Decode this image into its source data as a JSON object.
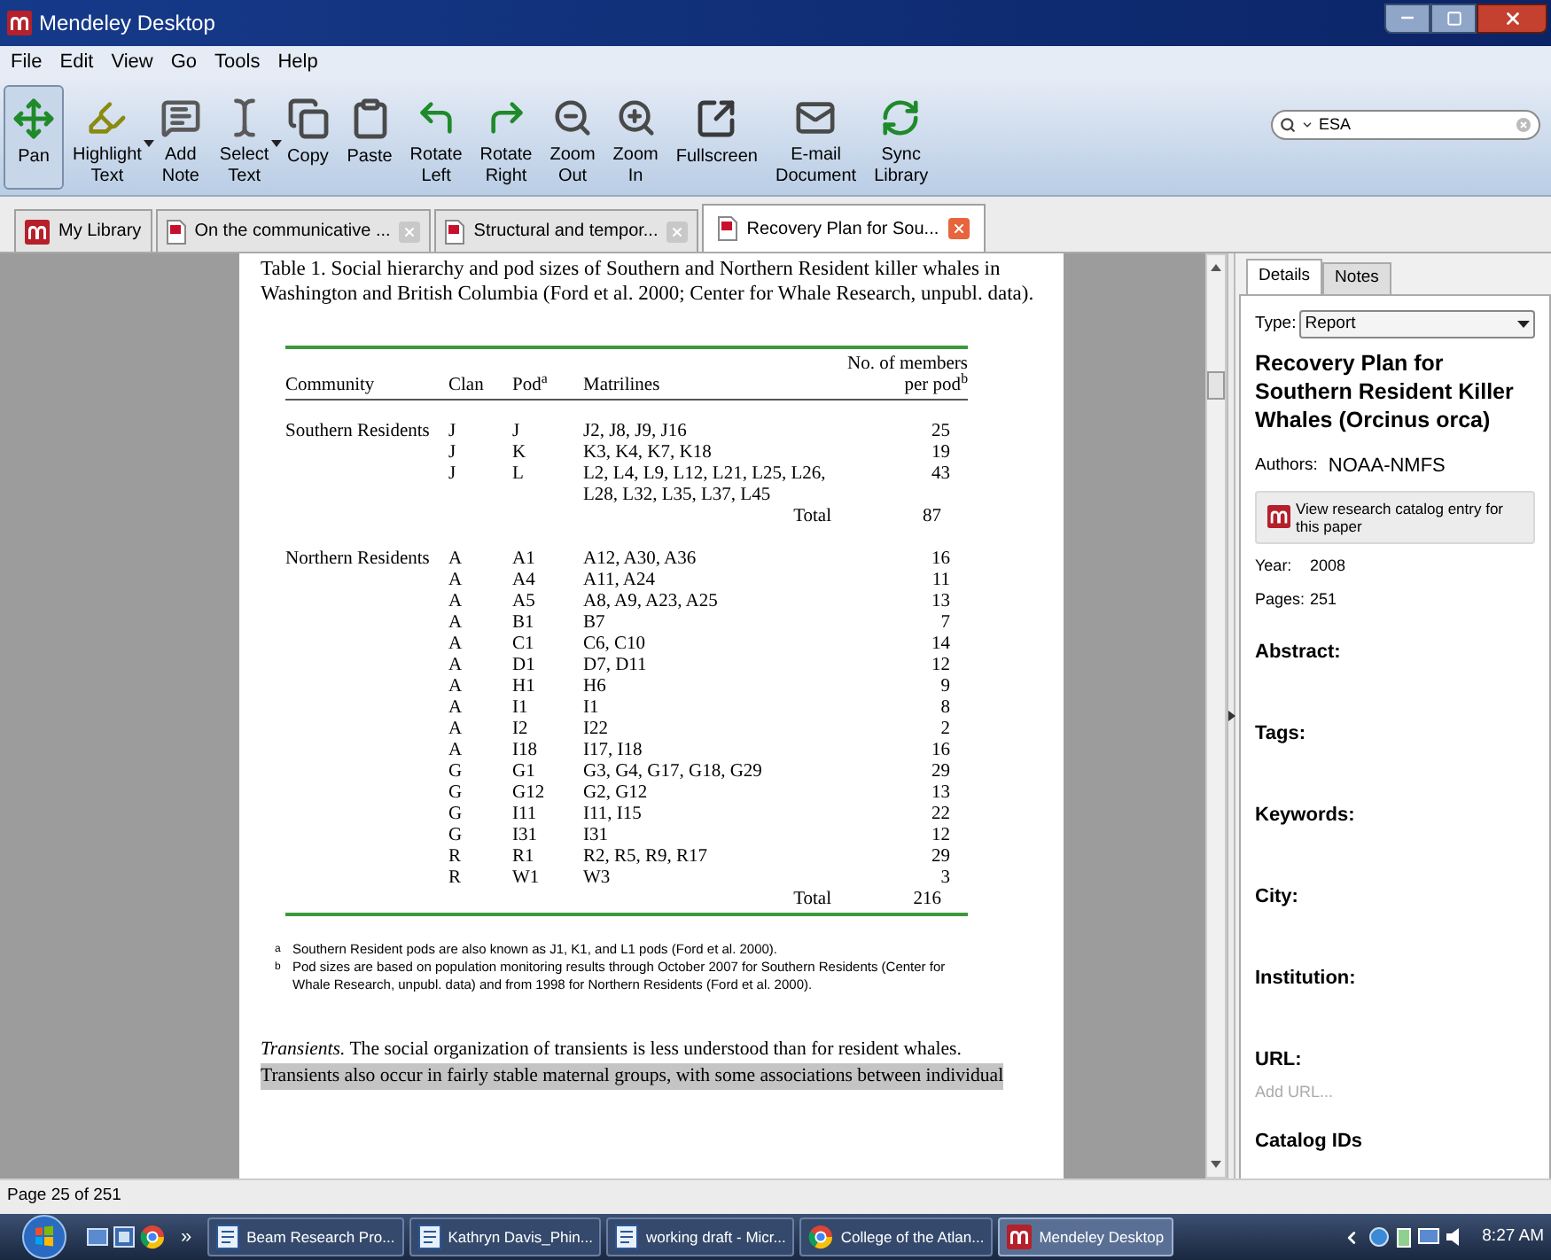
{
  "window": {
    "title": "Mendeley Desktop"
  },
  "menu": [
    "File",
    "Edit",
    "View",
    "Go",
    "Tools",
    "Help"
  ],
  "toolbar": [
    {
      "label": "Pan",
      "selected": true,
      "has_menu": false
    },
    {
      "label": "Highlight Text",
      "selected": false,
      "has_menu": true
    },
    {
      "label": "Add Note",
      "selected": false,
      "has_menu": false
    },
    {
      "label": "Select Text",
      "selected": false,
      "has_menu": true
    },
    {
      "label": "Copy",
      "selected": false,
      "has_menu": false
    },
    {
      "label": "Paste",
      "selected": false,
      "has_menu": false
    },
    {
      "label": "Rotate Left",
      "selected": false,
      "has_menu": false
    },
    {
      "label": "Rotate Right",
      "selected": false,
      "has_menu": false
    },
    {
      "label": "Zoom Out",
      "selected": false,
      "has_menu": false
    },
    {
      "label": "Zoom In",
      "selected": false,
      "has_menu": false
    },
    {
      "label": "Fullscreen",
      "selected": false,
      "has_menu": false
    },
    {
      "label": "E-mail Document",
      "selected": false,
      "has_menu": false
    },
    {
      "label": "Sync Library",
      "selected": false,
      "has_menu": false
    }
  ],
  "search": {
    "value": "ESA"
  },
  "tabs": [
    {
      "label": "My Library",
      "kind": "library",
      "selected": false,
      "closable": false
    },
    {
      "label": "On the communicative ...",
      "kind": "pdf",
      "selected": false,
      "closable": true
    },
    {
      "label": "Structural and tempor...",
      "kind": "pdf",
      "selected": false,
      "closable": true
    },
    {
      "label": "Recovery Plan for Sou...",
      "kind": "pdf",
      "selected": true,
      "closable": true
    }
  ],
  "document": {
    "caption": "Table 1. Social hierarchy and pod sizes of Southern and Northern Resident killer whales in Washington and British Columbia (Ford et al. 2000; Center for Whale Research, unpubl. data).",
    "table": {
      "columns": [
        "Community",
        "Clan",
        "Pod$^{a}$",
        "Matrilines",
        "No. of members per pod$^{b}$"
      ],
      "groups": [
        {
          "community": "Southern Residents",
          "rows": [
            {
              "clan": "J",
              "pod": "J",
              "matrilines": "J2, J8, J9, J16",
              "members": "25"
            },
            {
              "clan": "J",
              "pod": "K",
              "matrilines": "K3, K4, K7, K18",
              "members": "19"
            },
            {
              "clan": "J",
              "pod": "L",
              "matrilines": "L2, L4, L9, L12, L21, L25, L26, L28, L32, L35, L37, L45",
              "members": "43"
            }
          ],
          "total_label": "Total",
          "total": "87"
        },
        {
          "community": "Northern Residents",
          "rows": [
            {
              "clan": "A",
              "pod": "A1",
              "matrilines": "A12, A30, A36",
              "members": "16"
            },
            {
              "clan": "A",
              "pod": "A4",
              "matrilines": "A11, A24",
              "members": "11"
            },
            {
              "clan": "A",
              "pod": "A5",
              "matrilines": "A8, A9, A23, A25",
              "members": "13"
            },
            {
              "clan": "A",
              "pod": "B1",
              "matrilines": "B7",
              "members": "7"
            },
            {
              "clan": "A",
              "pod": "C1",
              "matrilines": "C6, C10",
              "members": "14"
            },
            {
              "clan": "A",
              "pod": "D1",
              "matrilines": "D7, D11",
              "members": "12"
            },
            {
              "clan": "A",
              "pod": "H1",
              "matrilines": "H6",
              "members": "9"
            },
            {
              "clan": "A",
              "pod": "I1",
              "matrilines": "I1",
              "members": "8"
            },
            {
              "clan": "A",
              "pod": "I2",
              "matrilines": "I22",
              "members": "2"
            },
            {
              "clan": "A",
              "pod": "I18",
              "matrilines": "I17, I18",
              "members": "16"
            },
            {
              "clan": "G",
              "pod": "G1",
              "matrilines": "G3, G4, G17, G18, G29",
              "members": "29"
            },
            {
              "clan": "G",
              "pod": "G12",
              "matrilines": "G2, G12",
              "members": "13"
            },
            {
              "clan": "G",
              "pod": "I11",
              "matrilines": "I11, I15",
              "members": "22"
            },
            {
              "clan": "G",
              "pod": "I31",
              "matrilines": "I31",
              "members": "12"
            },
            {
              "clan": "R",
              "pod": "R1",
              "matrilines": "R2, R5, R9, R17",
              "members": "29"
            },
            {
              "clan": "R",
              "pod": "W1",
              "matrilines": "W3",
              "members": "3"
            }
          ],
          "total_label": "Total",
          "total": "216"
        }
      ]
    },
    "footnotes": [
      {
        "mark": "a",
        "text": "Southern Resident pods are also known as J1, K1, and L1 pods (Ford et al. 2000)."
      },
      {
        "mark": "b",
        "text": "Pod sizes are based on population monitoring results through October 2007 for Southern Residents (Center for Whale Research, unpubl. data) and from 1998 for Northern Residents (Ford et al. 2000)."
      }
    ],
    "paragraph_lines": [
      {
        "text": "*Transients.*  The social organization of transients is less understood than for resident whales.",
        "highlighted": false
      },
      {
        "text": "Transients also occur in fairly stable maternal groups, with some associations between individual",
        "highlighted": true
      }
    ]
  },
  "status_bar": "Page 25 of 251",
  "details": {
    "tabs": [
      {
        "label": "Details",
        "selected": true
      },
      {
        "label": "Notes",
        "selected": false
      }
    ],
    "type_label": "Type:",
    "type_value": "Report",
    "title": "Recovery Plan for Southern Resident Killer Whales (Orcinus orca)",
    "authors_label": "Authors:",
    "authors": "NOAA-NMFS",
    "catalog_button": "View research catalog entry for this paper",
    "fields": [
      {
        "label": "Year:",
        "value": "2008"
      },
      {
        "label": "Pages:",
        "value": "251"
      }
    ],
    "sections": [
      {
        "label": "Abstract:"
      },
      {
        "label": "Tags:"
      },
      {
        "label": "Keywords:"
      },
      {
        "label": "City:"
      },
      {
        "label": "Institution:"
      },
      {
        "label": "URL:",
        "placeholder": "Add URL..."
      },
      {
        "label": "Catalog IDs"
      }
    ]
  },
  "taskbar": {
    "overflow": "»",
    "tasks": [
      {
        "label": "Beam Research Pro...",
        "kind": "document",
        "selected": false
      },
      {
        "label": "Kathryn Davis_Phin...",
        "kind": "document",
        "selected": false
      },
      {
        "label": "working draft - Micr...",
        "kind": "document",
        "selected": false
      },
      {
        "label": "College of the Atlan...",
        "kind": "browser",
        "selected": false
      },
      {
        "label": "Mendeley Desktop",
        "kind": "mendeley",
        "selected": true
      }
    ],
    "clock": "8:27 AM"
  }
}
